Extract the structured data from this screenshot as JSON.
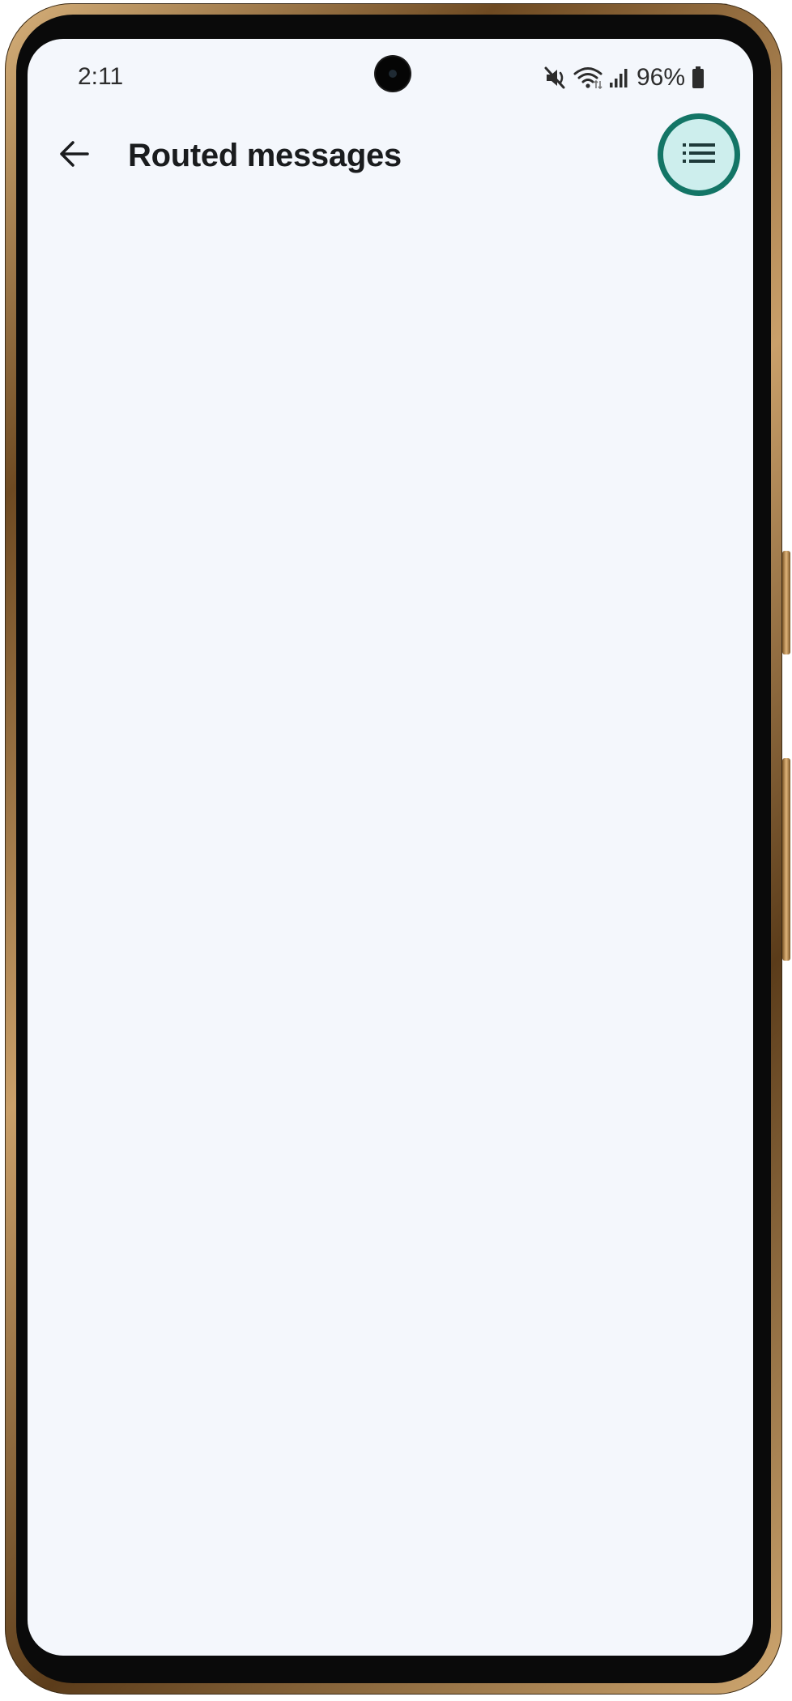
{
  "status_bar": {
    "time": "2:11",
    "battery_percent": "96%",
    "icons": [
      "mute-icon",
      "wifi-icon",
      "signal-icon",
      "battery-icon"
    ]
  },
  "app_bar": {
    "title": "Routed messages",
    "back_icon": "arrow-left-icon",
    "menu_icon": "list-icon"
  },
  "colors": {
    "screen_background": "#f4f7fc",
    "highlight_fill": "#cdeeed",
    "highlight_ring": "#137566",
    "text_primary": "#1a1c1e"
  }
}
